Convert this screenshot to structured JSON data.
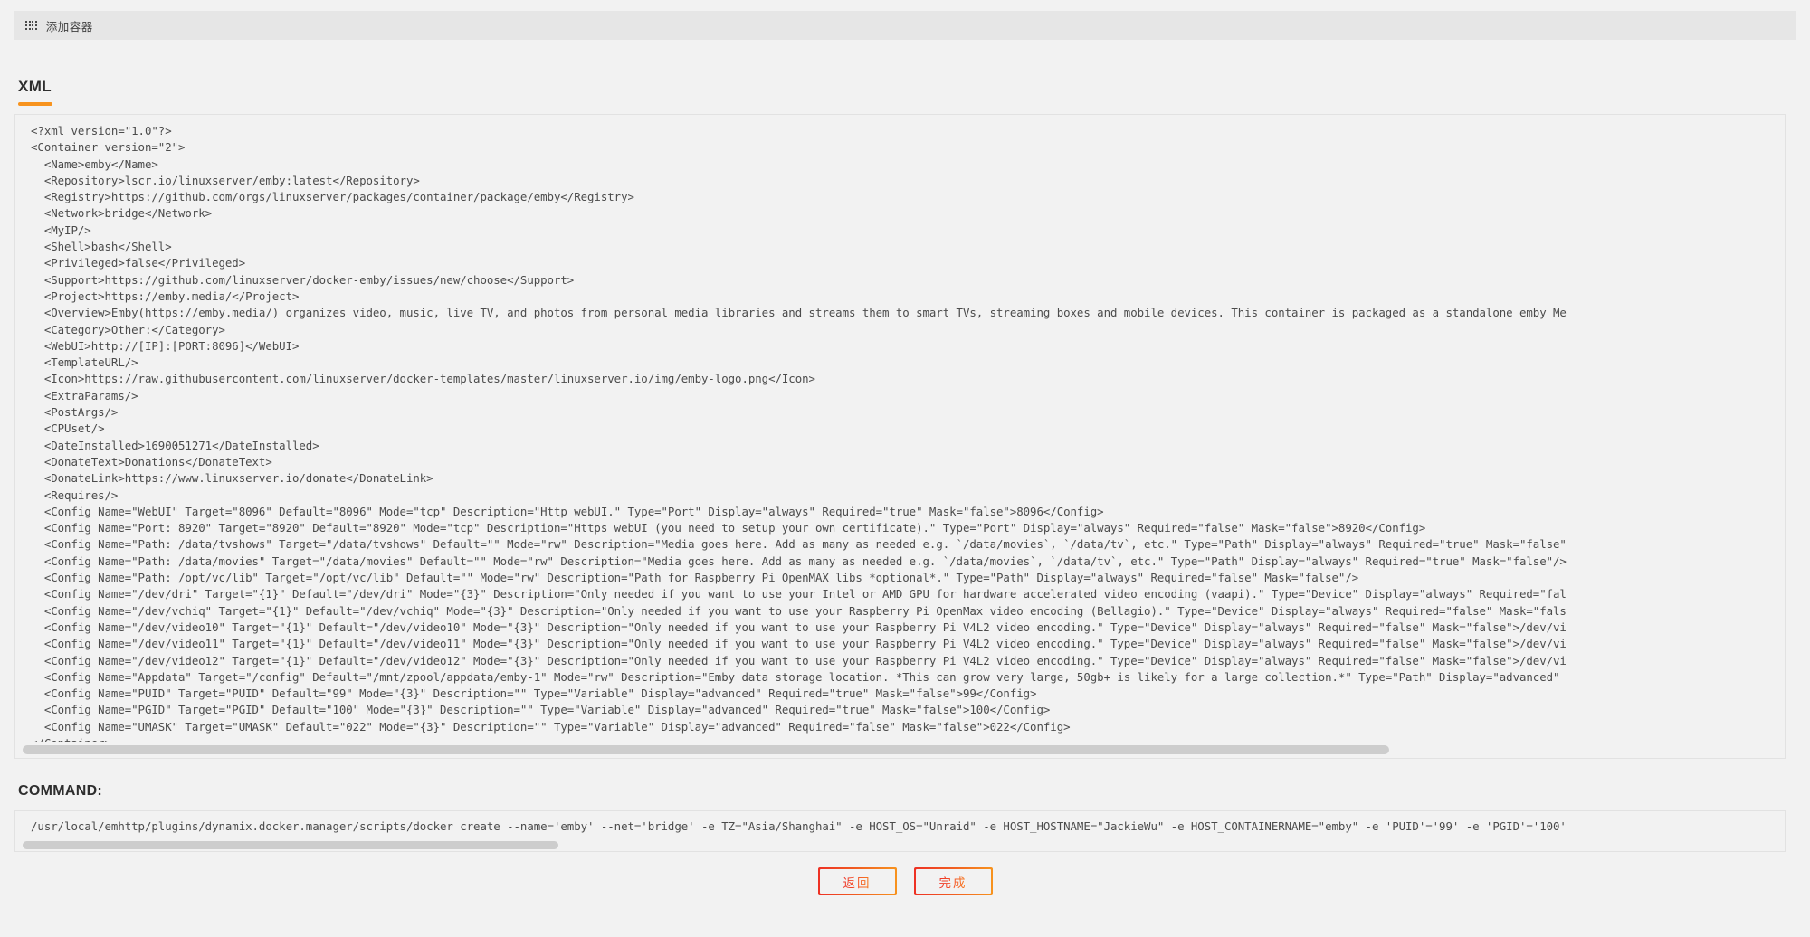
{
  "topbar": {
    "icon": "grid-icon",
    "title": "添加容器"
  },
  "tabs": [
    {
      "label": "XML",
      "active": true
    }
  ],
  "xml": {
    "content": "<?xml version=\"1.0\"?>\n<Container version=\"2\">\n  <Name>emby</Name>\n  <Repository>lscr.io/linuxserver/emby:latest</Repository>\n  <Registry>https://github.com/orgs/linuxserver/packages/container/package/emby</Registry>\n  <Network>bridge</Network>\n  <MyIP/>\n  <Shell>bash</Shell>\n  <Privileged>false</Privileged>\n  <Support>https://github.com/linuxserver/docker-emby/issues/new/choose</Support>\n  <Project>https://emby.media/</Project>\n  <Overview>Emby(https://emby.media/) organizes video, music, live TV, and photos from personal media libraries and streams them to smart TVs, streaming boxes and mobile devices. This container is packaged as a standalone emby Me\n  <Category>Other:</Category>\n  <WebUI>http://[IP]:[PORT:8096]</WebUI>\n  <TemplateURL/>\n  <Icon>https://raw.githubusercontent.com/linuxserver/docker-templates/master/linuxserver.io/img/emby-logo.png</Icon>\n  <ExtraParams/>\n  <PostArgs/>\n  <CPUset/>\n  <DateInstalled>1690051271</DateInstalled>\n  <DonateText>Donations</DonateText>\n  <DonateLink>https://www.linuxserver.io/donate</DonateLink>\n  <Requires/>\n  <Config Name=\"WebUI\" Target=\"8096\" Default=\"8096\" Mode=\"tcp\" Description=\"Http webUI.\" Type=\"Port\" Display=\"always\" Required=\"true\" Mask=\"false\">8096</Config>\n  <Config Name=\"Port: 8920\" Target=\"8920\" Default=\"8920\" Mode=\"tcp\" Description=\"Https webUI (you need to setup your own certificate).\" Type=\"Port\" Display=\"always\" Required=\"false\" Mask=\"false\">8920</Config>\n  <Config Name=\"Path: /data/tvshows\" Target=\"/data/tvshows\" Default=\"\" Mode=\"rw\" Description=\"Media goes here. Add as many as needed e.g. `/data/movies`, `/data/tv`, etc.\" Type=\"Path\" Display=\"always\" Required=\"true\" Mask=\"false\"\n  <Config Name=\"Path: /data/movies\" Target=\"/data/movies\" Default=\"\" Mode=\"rw\" Description=\"Media goes here. Add as many as needed e.g. `/data/movies`, `/data/tv`, etc.\" Type=\"Path\" Display=\"always\" Required=\"true\" Mask=\"false\"/>\n  <Config Name=\"Path: /opt/vc/lib\" Target=\"/opt/vc/lib\" Default=\"\" Mode=\"rw\" Description=\"Path for Raspberry Pi OpenMAX libs *optional*.\" Type=\"Path\" Display=\"always\" Required=\"false\" Mask=\"false\"/>\n  <Config Name=\"/dev/dri\" Target=\"{1}\" Default=\"/dev/dri\" Mode=\"{3}\" Description=\"Only needed if you want to use your Intel or AMD GPU for hardware accelerated video encoding (vaapi).\" Type=\"Device\" Display=\"always\" Required=\"fal\n  <Config Name=\"/dev/vchiq\" Target=\"{1}\" Default=\"/dev/vchiq\" Mode=\"{3}\" Description=\"Only needed if you want to use your Raspberry Pi OpenMax video encoding (Bellagio).\" Type=\"Device\" Display=\"always\" Required=\"false\" Mask=\"fals\n  <Config Name=\"/dev/video10\" Target=\"{1}\" Default=\"/dev/video10\" Mode=\"{3}\" Description=\"Only needed if you want to use your Raspberry Pi V4L2 video encoding.\" Type=\"Device\" Display=\"always\" Required=\"false\" Mask=\"false\">/dev/vi\n  <Config Name=\"/dev/video11\" Target=\"{1}\" Default=\"/dev/video11\" Mode=\"{3}\" Description=\"Only needed if you want to use your Raspberry Pi V4L2 video encoding.\" Type=\"Device\" Display=\"always\" Required=\"false\" Mask=\"false\">/dev/vi\n  <Config Name=\"/dev/video12\" Target=\"{1}\" Default=\"/dev/video12\" Mode=\"{3}\" Description=\"Only needed if you want to use your Raspberry Pi V4L2 video encoding.\" Type=\"Device\" Display=\"always\" Required=\"false\" Mask=\"false\">/dev/vi\n  <Config Name=\"Appdata\" Target=\"/config\" Default=\"/mnt/zpool/appdata/emby-1\" Mode=\"rw\" Description=\"Emby data storage location. *This can grow very large, 50gb+ is likely for a large collection.*\" Type=\"Path\" Display=\"advanced\"\n  <Config Name=\"PUID\" Target=\"PUID\" Default=\"99\" Mode=\"{3}\" Description=\"\" Type=\"Variable\" Display=\"advanced\" Required=\"true\" Mask=\"false\">99</Config>\n  <Config Name=\"PGID\" Target=\"PGID\" Default=\"100\" Mode=\"{3}\" Description=\"\" Type=\"Variable\" Display=\"advanced\" Required=\"true\" Mask=\"false\">100</Config>\n  <Config Name=\"UMASK\" Target=\"UMASK\" Default=\"022\" Mode=\"{3}\" Description=\"\" Type=\"Variable\" Display=\"advanced\" Required=\"false\" Mask=\"false\">022</Config>\n</Container>"
  },
  "command": {
    "label": "COMMAND:",
    "value": "/usr/local/emhttp/plugins/dynamix.docker.manager/scripts/docker create --name='emby' --net='bridge' -e TZ=\"Asia/Shanghai\" -e HOST_OS=\"Unraid\" -e HOST_HOSTNAME=\"JackieWu\" -e HOST_CONTAINERNAME=\"emby\" -e 'PUID'='99' -e 'PGID'='100'"
  },
  "buttons": [
    {
      "name": "back",
      "label": "返回"
    },
    {
      "name": "done",
      "label": "完成"
    }
  ],
  "colors": {
    "accent_orange": "#f7931e",
    "accent_red": "#ee3124",
    "page_bg": "#f2f2f2",
    "topbar_bg": "#e6e6e6",
    "panel_border": "#e2e2e2",
    "scrollbar_thumb": "#cdcdcd"
  }
}
